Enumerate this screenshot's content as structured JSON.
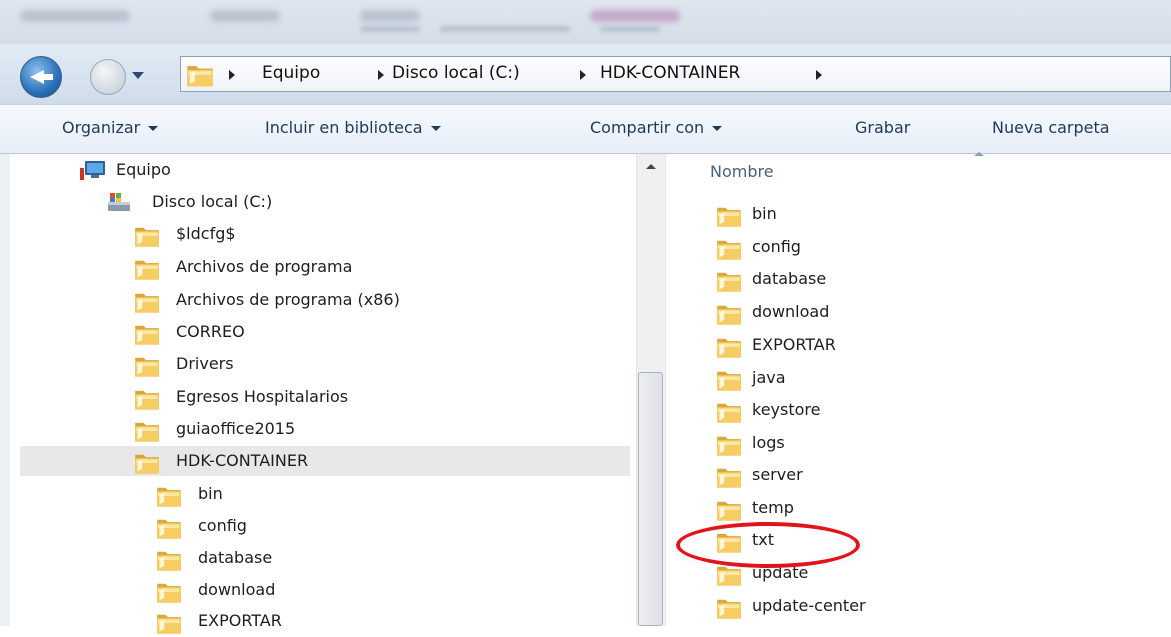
{
  "breadcrumb": [
    "Equipo",
    "Disco local (C:)",
    "HDK-CONTAINER"
  ],
  "toolbar": {
    "organize": "Organizar",
    "include_library": "Incluir en biblioteca",
    "share_with": "Compartir con",
    "burn": "Grabar",
    "new_folder": "Nueva carpeta"
  },
  "nav_tree": {
    "computer": "Equipo",
    "local_disk": "Disco local (C:)",
    "folders": [
      "$ldcfg$",
      "Archivos de programa",
      "Archivos de programa (x86)",
      "CORREO",
      "Drivers",
      "Egresos Hospitalarios",
      "guiaoffice2015",
      "HDK-CONTAINER"
    ],
    "selected": "HDK-CONTAINER",
    "subfolders": [
      "bin",
      "config",
      "database",
      "download",
      "EXPORTAR"
    ]
  },
  "content": {
    "column_header": "Nombre",
    "items": [
      "bin",
      "config",
      "database",
      "download",
      "EXPORTAR",
      "java",
      "keystore",
      "logs",
      "server",
      "temp",
      "txt",
      "update",
      "update-center"
    ],
    "highlighted": "txt"
  },
  "colors": {
    "highlight_ring": "#e1141c",
    "folder": "#f2c24e",
    "toolbar_text": "#1e395b"
  }
}
